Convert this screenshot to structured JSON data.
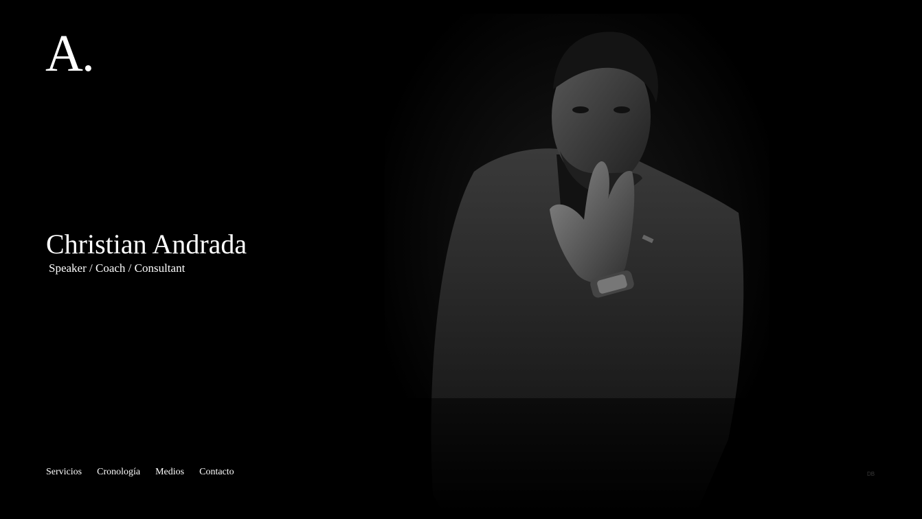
{
  "logo": {
    "text": "A."
  },
  "hero": {
    "title": "Christian Andrada",
    "subtitle": "Speaker / Coach / Consultant",
    "image_subject": "black-and-white portrait of a man in a blazer with hand near mouth"
  },
  "nav": {
    "items": [
      {
        "label": "Servicios"
      },
      {
        "label": "Cronología"
      },
      {
        "label": "Medios"
      },
      {
        "label": "Contacto"
      }
    ]
  },
  "credit": {
    "text": "DB"
  },
  "colors": {
    "background": "#000000",
    "text": "#ffffff",
    "credit": "#3a3a3a"
  }
}
